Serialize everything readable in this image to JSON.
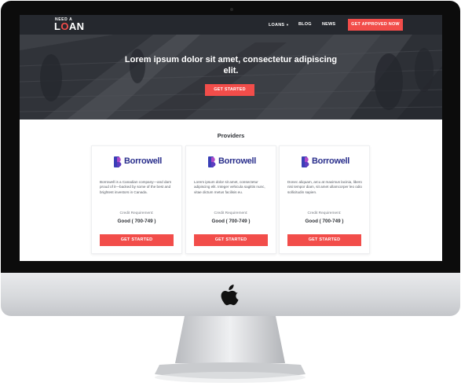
{
  "brand": {
    "logo_top": "NEED A",
    "logo_main_1": "L",
    "logo_main_o": "O",
    "logo_main_2": "AN"
  },
  "nav": {
    "items": [
      {
        "label": "LOANS",
        "dropdown": true
      },
      {
        "label": "BLOG"
      },
      {
        "label": "NEWS"
      }
    ],
    "cta_label": "GET APPROVED NOW"
  },
  "hero": {
    "title": "Lorem ipsum dolor sit amet, consectetur adipiscing elit.",
    "button_label": "GET STARTED"
  },
  "providers": {
    "title": "Providers",
    "cards": [
      {
        "brand": "Borrowell",
        "description": "Borrowell is a Canadian company—and darn proud of it—backed by some of the best and brightest investors in Canada.",
        "requirement_label": "Credit Requirement:",
        "requirement_value": "Good ( 700-749 )",
        "button_label": "GET STARTED"
      },
      {
        "brand": "Borrowell",
        "description": "Lorem ipsum dolor sit amet, consectetur adipiscing elit. Integer vehicula sagittis nunc, vitae dictum metus facilisis eu.",
        "requirement_label": "Credit Requirement:",
        "requirement_value": "Good ( 700-749 )",
        "button_label": "GET STARTED"
      },
      {
        "brand": "Borrowell",
        "description": "Donec aliquam, arcu at maximus lacinia, libero nisi tempor diam, sit amet ullamcorper leo odio sollicitudin sapien.",
        "requirement_label": "Credit Requirement:",
        "requirement_value": "Good ( 700-749 )",
        "button_label": "GET STARTED"
      }
    ]
  },
  "colors": {
    "accent": "#f24d4a",
    "navbar": "#25282e",
    "brand_text": "#2a2f8c"
  },
  "icons": {
    "device_logo": "apple-logo-icon",
    "provider_mark": "borrowell-mark-icon",
    "dropdown": "caret-down-icon"
  }
}
